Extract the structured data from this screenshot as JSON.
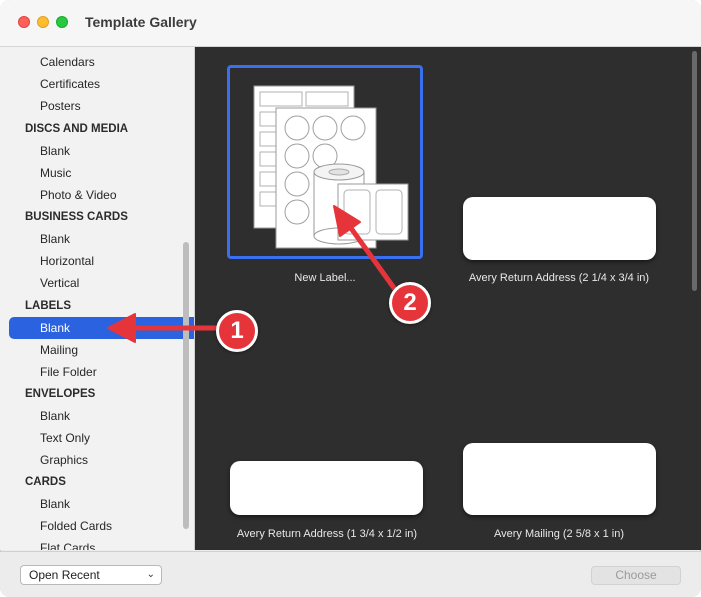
{
  "window": {
    "title": "Template Gallery"
  },
  "sidebar": {
    "rows": [
      {
        "type": "item",
        "label": "Calendars"
      },
      {
        "type": "item",
        "label": "Certificates"
      },
      {
        "type": "item",
        "label": "Posters"
      },
      {
        "type": "head",
        "label": "DISCS AND MEDIA"
      },
      {
        "type": "item",
        "label": "Blank"
      },
      {
        "type": "item",
        "label": "Music"
      },
      {
        "type": "item",
        "label": "Photo & Video"
      },
      {
        "type": "head",
        "label": "BUSINESS CARDS"
      },
      {
        "type": "item",
        "label": "Blank"
      },
      {
        "type": "item",
        "label": "Horizontal"
      },
      {
        "type": "item",
        "label": "Vertical"
      },
      {
        "type": "head",
        "label": "LABELS"
      },
      {
        "type": "item",
        "label": "Blank",
        "selected": true
      },
      {
        "type": "item",
        "label": "Mailing"
      },
      {
        "type": "item",
        "label": "File Folder"
      },
      {
        "type": "head",
        "label": "ENVELOPES"
      },
      {
        "type": "item",
        "label": "Blank"
      },
      {
        "type": "item",
        "label": "Text Only"
      },
      {
        "type": "item",
        "label": "Graphics"
      },
      {
        "type": "head",
        "label": "CARDS"
      },
      {
        "type": "item",
        "label": "Blank"
      },
      {
        "type": "item",
        "label": "Folded Cards"
      },
      {
        "type": "item",
        "label": "Flat Cards"
      }
    ]
  },
  "gallery": {
    "templates": [
      {
        "label": "New Label...",
        "selected": true
      },
      {
        "label": "Avery Return Address (2 1/4 x 3/4 in)"
      },
      {
        "label": "Avery Return Address (1 3/4 x 1/2 in)"
      },
      {
        "label": "Avery Mailing (2 5/8 x 1 in)"
      }
    ]
  },
  "footer": {
    "open_recent": "Open Recent",
    "choose": "Choose"
  },
  "annotations": {
    "badge1": "1",
    "badge2": "2",
    "arrow_color": "#e6353a"
  },
  "colors": {
    "selection": "#2b62e0",
    "gallery_bg": "#2e2e2e"
  }
}
